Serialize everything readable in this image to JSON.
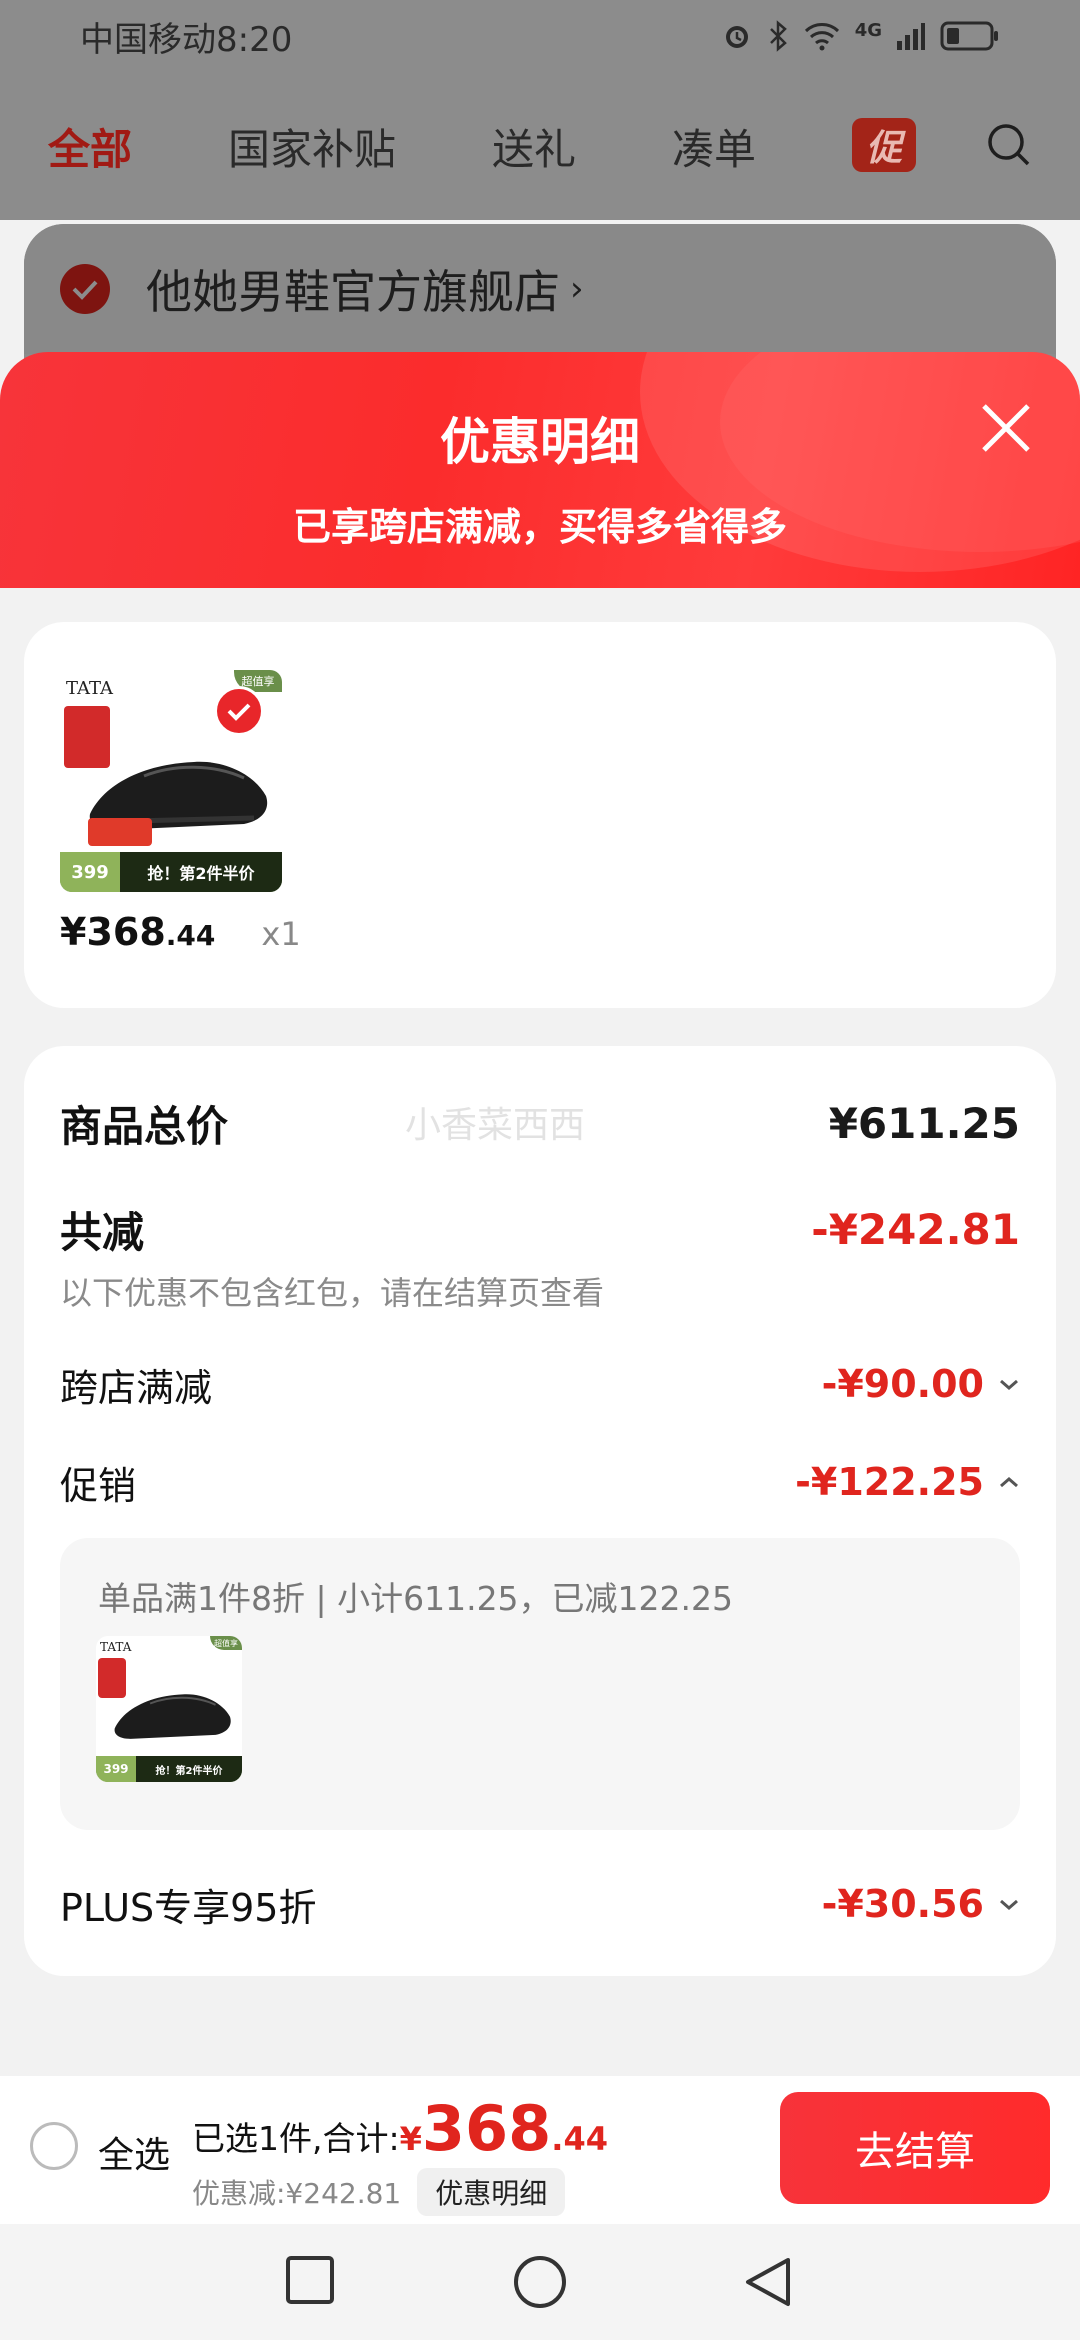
{
  "status_bar": {
    "carrier_time": "中国移动8:20",
    "network": "4G"
  },
  "top_nav": {
    "tabs": [
      "全部",
      "国家补贴",
      "送礼",
      "凑单"
    ],
    "promo_badge": "促"
  },
  "store": {
    "name": "他她男鞋官方旗舰店",
    "chevron": "›"
  },
  "sheet": {
    "title": "优惠明细",
    "subtitle": "已享跨店满减，买得多省得多",
    "watermark": "小香菜西西"
  },
  "product": {
    "image_brand": "TATA",
    "image_price_tag": "399",
    "image_promo_text": "抢！第2件半价",
    "image_corner": "超值享",
    "price_main": "¥368",
    "price_decimal": ".44",
    "quantity": "x1"
  },
  "details": {
    "total_label": "商品总价",
    "total_value": "¥611.25",
    "reduce_label": "共减",
    "reduce_value": "-¥242.81",
    "reduce_note": "以下优惠不包含红包，请在结算页查看",
    "cross_store_label": "跨店满减",
    "cross_store_value": "-¥90.00",
    "promo_label": "促销",
    "promo_value": "-¥122.25",
    "promo_desc": "单品满1件8折 | 小计611.25，已减122.25",
    "plus_label": "PLUS专享95折",
    "plus_value": "-¥30.56"
  },
  "bottom_bar": {
    "select_all": "全选",
    "selected_label": "已选1件,合计:",
    "currency": "¥",
    "total_int": "368",
    "total_dec": ".44",
    "discount_label": "优惠减:¥242.81",
    "detail_pill": "优惠明细",
    "checkout": "去结算"
  },
  "colors": {
    "accent_red": "#e0251e",
    "header_red": "#fb2c2c",
    "promo_green": "#5f8f3a"
  }
}
